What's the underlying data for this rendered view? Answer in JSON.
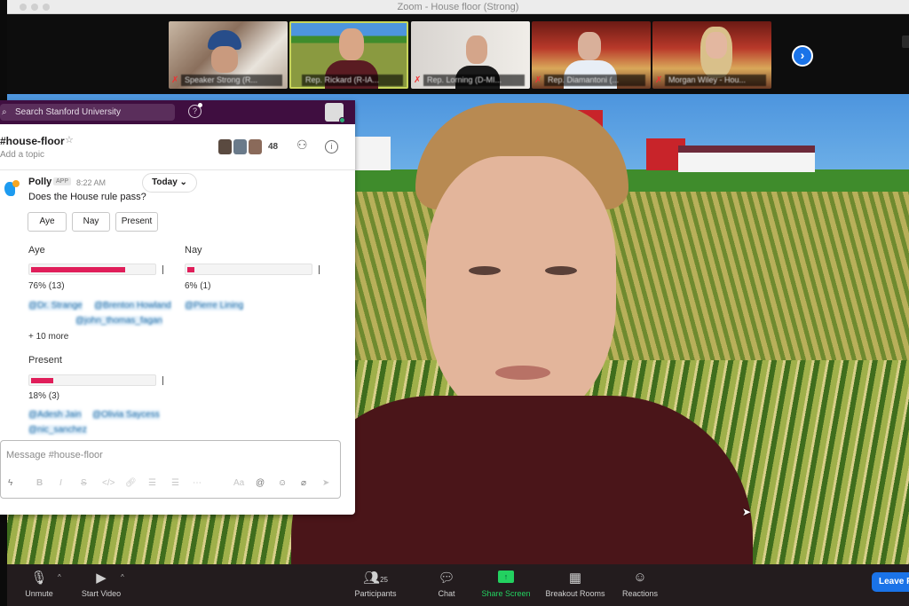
{
  "window": {
    "title": "Zoom - House floor (Strong)"
  },
  "thumbnails": [
    {
      "name": "Speaker Strong (R...",
      "muted": true,
      "active": false
    },
    {
      "name": "Rep. Rickard (R-IA...",
      "muted": false,
      "active": true
    },
    {
      "name": "Rep. Lorning (D-MI...",
      "muted": true,
      "active": false
    },
    {
      "name": "Rep. Diamantoni (...",
      "muted": true,
      "active": false
    },
    {
      "name": "Morgan Wiley - Hou...",
      "muted": true,
      "active": false
    }
  ],
  "slack": {
    "search_placeholder": "Search Stanford University",
    "help_icon": "?",
    "channel": {
      "name": "#house-floor",
      "topic": "Add a topic",
      "member_count": "48"
    },
    "message": {
      "sender": "Polly",
      "tag": "APP",
      "time": "8:22 AM",
      "date_pill": "Today ⌄",
      "text": "Does the House rule pass?",
      "buttons": [
        "Aye",
        "Nay",
        "Present"
      ]
    },
    "poll": {
      "options": [
        {
          "label": "Aye",
          "percent": 76,
          "count": 13,
          "result": "76% (13)",
          "voters": [
            "@Dr. Strange",
            "@Brenton Howland",
            "@john_thomas_fagan"
          ],
          "more": "+ 10 more"
        },
        {
          "label": "Nay",
          "percent": 6,
          "count": 1,
          "result": "6% (1)",
          "voters": [
            "@Pierre Lining"
          ],
          "more": ""
        },
        {
          "label": "Present",
          "percent": 18,
          "count": 3,
          "result": "18% (3)",
          "voters": [
            "@Adesh Jain",
            "@Olivia Saycess",
            "@nic_sanchez"
          ],
          "more": ""
        }
      ]
    },
    "composer": {
      "placeholder": "Message #house-floor"
    },
    "colors": {
      "sidebar": "#3f0e40",
      "bar": "#e01e5a",
      "mention": "#1264a3"
    }
  },
  "toolbar": {
    "unmute": "Unmute",
    "start_video": "Start Video",
    "participants": "Participants",
    "participant_count": "25",
    "chat": "Chat",
    "share_screen": "Share Screen",
    "breakout_rooms": "Breakout Rooms",
    "reactions": "Reactions",
    "leave": "Leave Room"
  }
}
